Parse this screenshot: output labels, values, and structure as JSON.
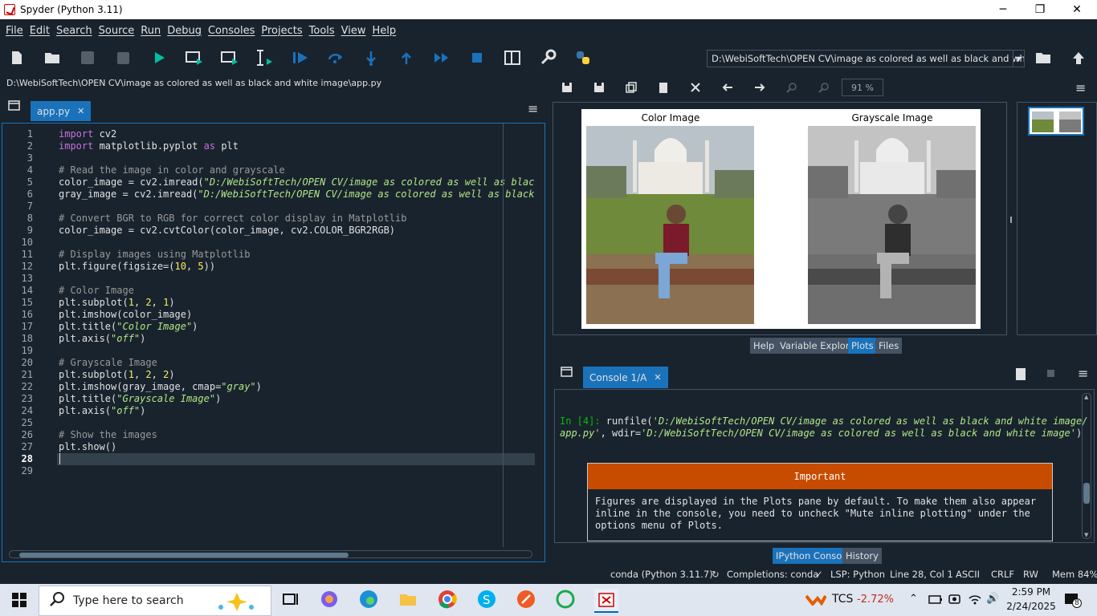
{
  "window": {
    "title": "Spyder (Python 3.11)",
    "minimize": "─",
    "maximize": "❐",
    "close": "✕"
  },
  "menu": [
    "File",
    "Edit",
    "Search",
    "Source",
    "Run",
    "Debug",
    "Consoles",
    "Projects",
    "Tools",
    "View",
    "Help"
  ],
  "toolbar": {
    "working_dir": "D:\\WebiSoftTech\\OPEN CV\\image as colored as well as black and white image"
  },
  "editor": {
    "file_path": "D:\\WebiSoftTech\\OPEN CV\\image as colored as well as black and white image\\app.py",
    "tab_label": "app.py",
    "tab_close": "✕",
    "current_line": 28,
    "line_numbers": [
      "1",
      "2",
      "3",
      "4",
      "5",
      "6",
      "7",
      "8",
      "9",
      "10",
      "11",
      "12",
      "13",
      "14",
      "15",
      "16",
      "17",
      "18",
      "19",
      "20",
      "21",
      "22",
      "23",
      "24",
      "25",
      "26",
      "27",
      "28",
      "29"
    ]
  },
  "plots": {
    "zoom": "91 %",
    "figure": {
      "left_title": "Color Image",
      "right_title": "Grayscale Image"
    },
    "pane_tabs": [
      "Help",
      "Variable Explorer",
      "Plots",
      "Files"
    ],
    "selected_tab": "Plots"
  },
  "console": {
    "tab_label": "Console 1/A",
    "tab_close": "✕",
    "prompt": "In [4]:",
    "cmd_line1": " runfile(",
    "cmd_str1": "'D:/WebiSoftTech/OPEN CV/image as colored as well as black and white image/",
    "cmd_str2": "app.py'",
    "cmd_mid": ", wdir=",
    "cmd_str3": "'D:/WebiSoftTech/OPEN CV/image as colored as well as black and white image'",
    "cmd_end": ")",
    "important_title": "Important",
    "important_body": "Figures are displayed in the Plots pane by default. To make them also appear\ninline in the console, you need to uncheck \"Mute inline plotting\" under the\noptions menu of Plots.",
    "bottom_tabs": [
      "IPython Console",
      "History"
    ],
    "selected_tab": "IPython Console"
  },
  "status": {
    "env": "conda (Python 3.11.7)",
    "completions": "Completions: conda",
    "lsp": "LSP: Python",
    "position": "Line 28, Col 1",
    "encoding": "ASCII",
    "eol": "CRLF",
    "rw": "RW",
    "mem": "Mem 84%"
  },
  "taskbar": {
    "search_placeholder": "Type here to search",
    "stock_name": "TCS",
    "stock_change": "-2.72%",
    "time": "2:59 PM",
    "date": "2/24/2025",
    "notifications": "8"
  },
  "colors": {
    "accent": "#1a72bb",
    "background": "#19232d",
    "important": "#c84c00",
    "string": "#b0e686",
    "keyword": "#c670e0",
    "number": "#faed5c",
    "comment": "#999999"
  }
}
